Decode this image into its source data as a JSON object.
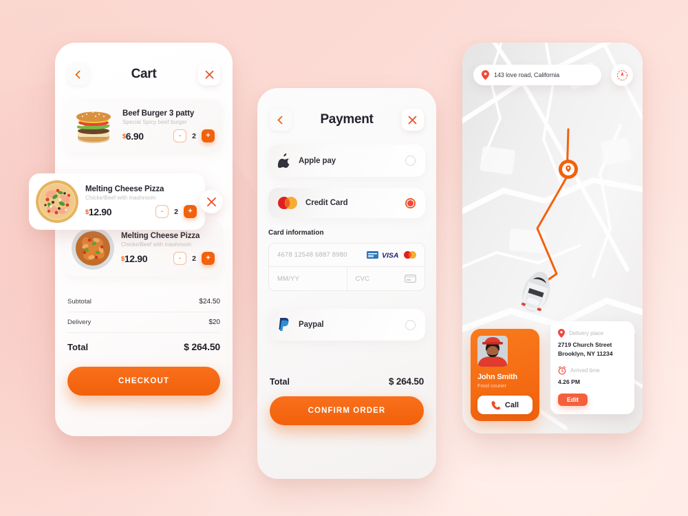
{
  "theme": {
    "accent": "#F2610C",
    "accent_light": "#F97B1D",
    "background_pink": "#FBD9D2",
    "red": "#F0483A",
    "text_dark": "#22222B",
    "text_muted": "#C2BFBE"
  },
  "cart_screen": {
    "title": "Cart",
    "back_icon": "chevron-left-icon",
    "close_icon": "close-icon",
    "items": [
      {
        "name": "Beef Burger 3 patty",
        "description": "Special Spicy beef burger",
        "currency": "$",
        "price": "6.90",
        "quantity": "2",
        "minus": "-",
        "plus": "+",
        "thumb": "beef-burger-photo"
      },
      {
        "name": "Melting Cheese  Pizza",
        "description": "Chicke/Beef with mashroom",
        "currency": "$",
        "price": "12.90",
        "quantity": "2",
        "minus": "-",
        "plus": "+",
        "thumb": "cheese-pizza-photo"
      },
      {
        "name": "Melting Cheese  Pizza",
        "description": "Chicke/Beef with mashroom",
        "currency": "$",
        "price": "12.90",
        "quantity": "2",
        "minus": "-",
        "plus": "+",
        "thumb": "pasta-bowl-photo"
      }
    ],
    "summary": [
      {
        "label": "Subtotal",
        "value": "$24.50"
      },
      {
        "label": "Delivery",
        "value": "$20"
      }
    ],
    "total": {
      "label": "Total",
      "value": "$ 264.50"
    },
    "checkout_label": "CHECKOUT"
  },
  "payment_screen": {
    "title": "Payment",
    "back_icon": "chevron-left-icon",
    "close_icon": "close-icon",
    "methods": [
      {
        "label": "Apple pay",
        "icon": "apple-icon",
        "selected": false
      },
      {
        "label": "Credit Card",
        "icon": "mastercard-icon",
        "selected": true
      },
      {
        "label": "Paypal",
        "icon": "paypal-icon",
        "selected": false
      }
    ],
    "card_information": {
      "section_title": "Card information",
      "number_placeholder": "4678 12548 6887 8980",
      "expiry_placeholder": "MM/YY",
      "cvc_placeholder": "CVC",
      "brands": [
        "amex-icon",
        "visa-icon",
        "mastercard-icon"
      ],
      "cvc_hint_icon": "card-back-icon"
    },
    "total": {
      "label": "Total",
      "value": "$ 264.50"
    },
    "confirm_label": "CONFIRM ORDER"
  },
  "map_screen": {
    "search": {
      "value": "143 love road, California",
      "pin_icon": "location-pin-icon"
    },
    "locate_icon": "compass-icon",
    "destination_pin_icon": "destination-pin-icon",
    "vehicle_icon": "car-top-view-icon",
    "courier": {
      "name": "John Smith",
      "role": "Food courier",
      "avatar": "courier-avatar-photo",
      "call_label": "Call",
      "call_icon": "phone-icon"
    },
    "delivery": {
      "place_label": "Delivery place",
      "place_icon": "location-pin-icon",
      "address_line1": "2719 Church Street",
      "address_line2": "Brooklyn, NY 11234",
      "time_label": "Arrived time",
      "time_icon": "alarm-clock-icon",
      "time_value": "4.26 PM",
      "edit_label": "Edit"
    }
  }
}
